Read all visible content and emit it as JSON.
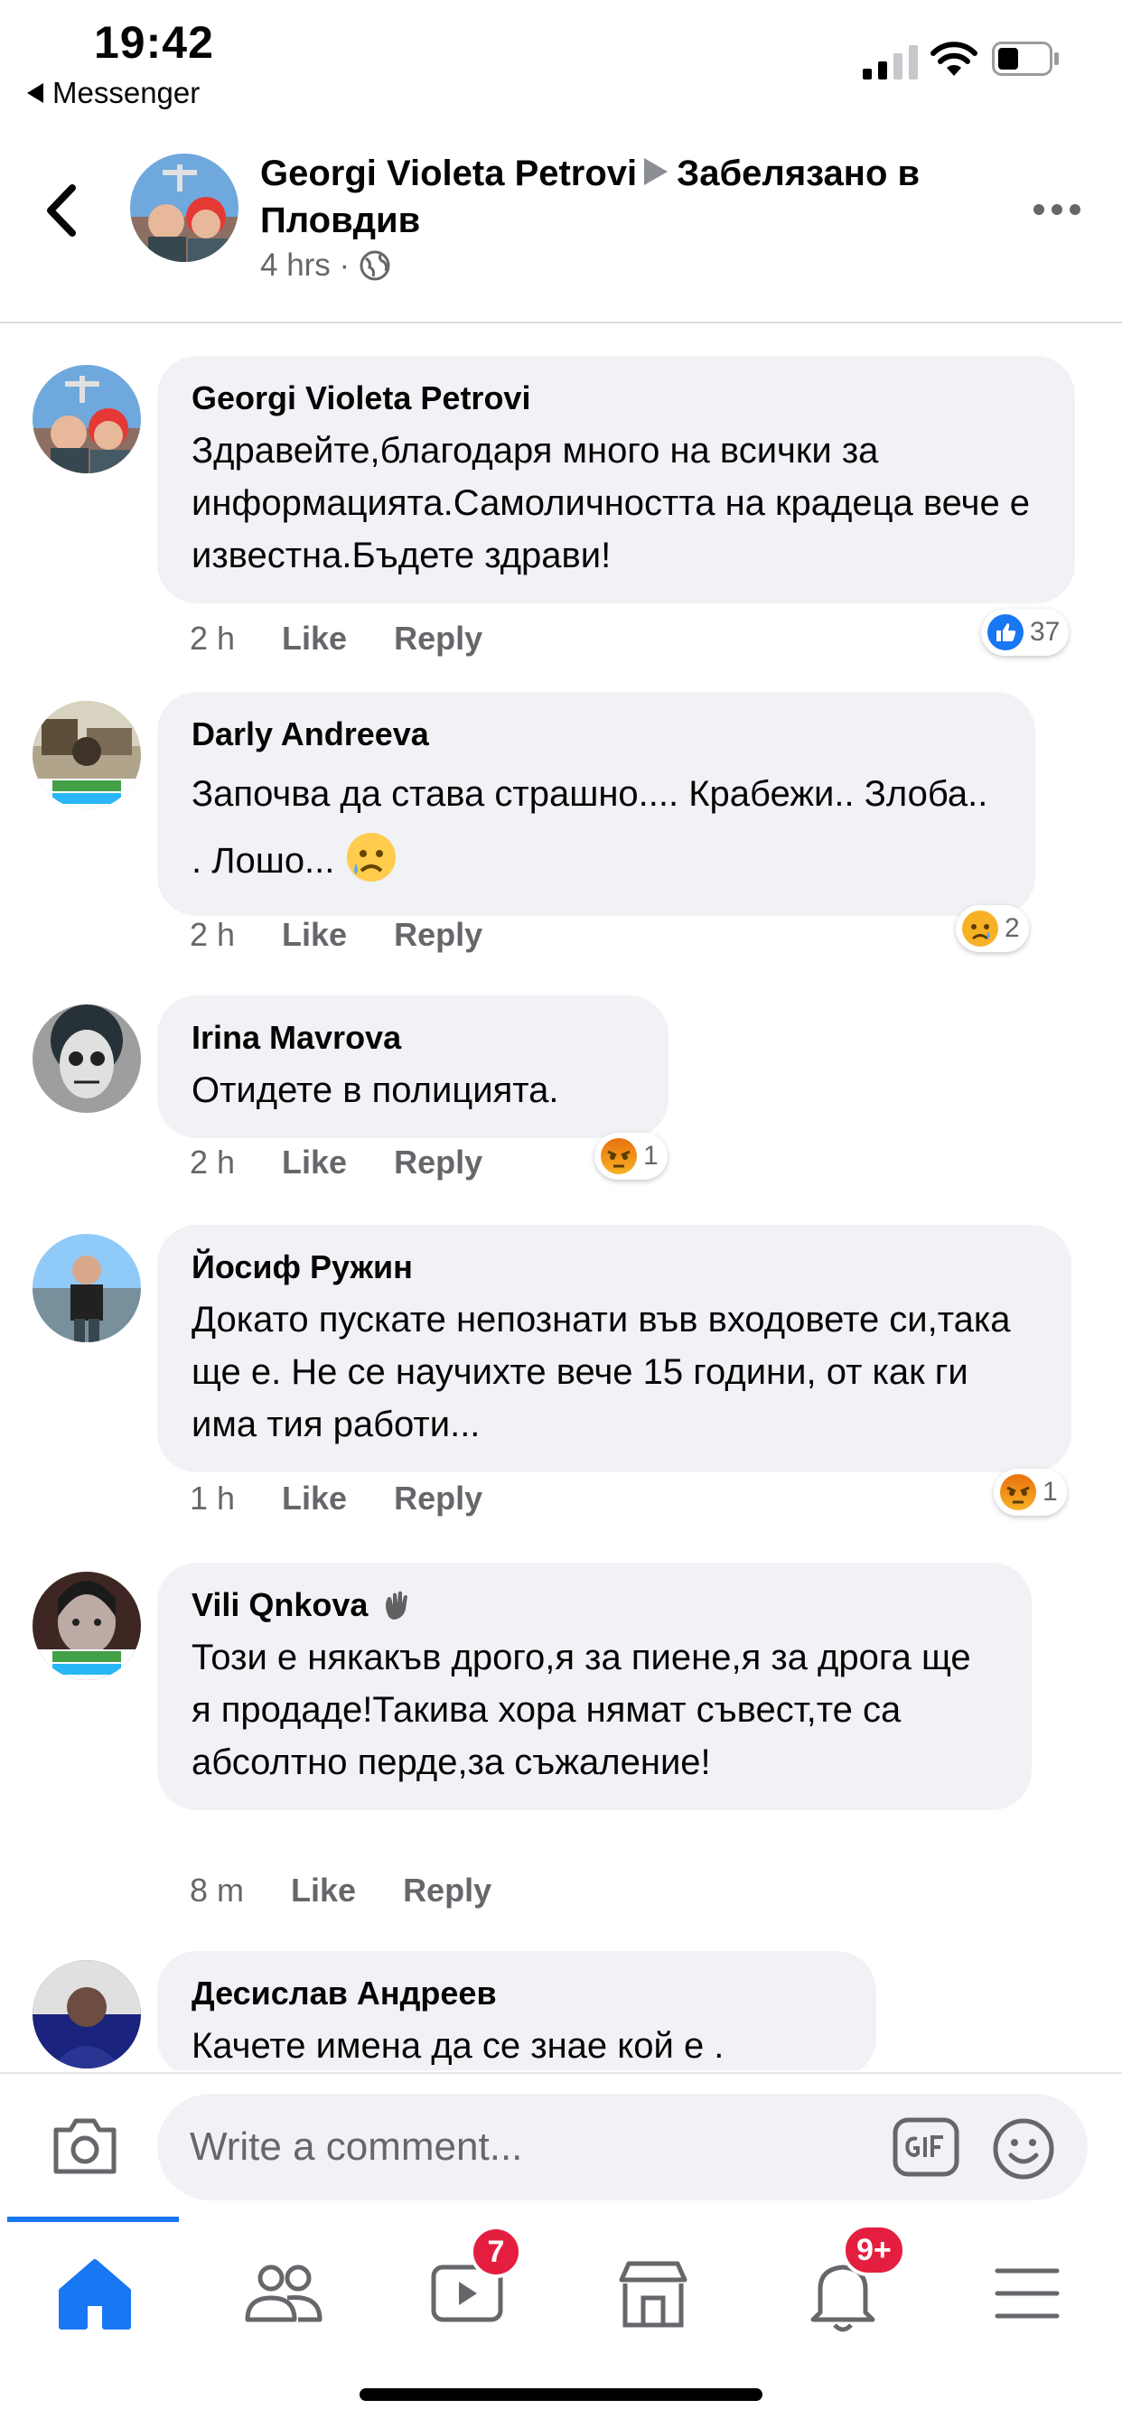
{
  "status_bar": {
    "time": "19:42",
    "back_app": "Messenger"
  },
  "header": {
    "author": "Georgi Violeta Petrovi",
    "location": "Забелязано в Пловдив",
    "meta": "4 hrs ·"
  },
  "comments": [
    {
      "author": "Georgi Violeta Petrovi",
      "text": "Здравейте,благодаря много на всички за информацията.Самоличността на крадеца вече е известна.Бъдете здрави!",
      "time": "2 h",
      "like": "Like",
      "reply": "Reply",
      "reaction": "like",
      "reaction_count": "37"
    },
    {
      "author": "Darly Andreeva",
      "text": "Започва да става страшно.... Крабежи.. Злоба.. . Лошо...",
      "time": "2 h",
      "like": "Like",
      "reply": "Reply",
      "reaction": "sad",
      "reaction_count": "2"
    },
    {
      "author": "Irina Mavrova",
      "text": "Отидете в полицията.",
      "time": "2 h",
      "like": "Like",
      "reply": "Reply",
      "reaction": "angry",
      "reaction_count": "1"
    },
    {
      "author": "Йосиф Ружин",
      "text": "Докато пускате непознати във входовете си,така ще е. Не се научихте вече 15 години, от как ги има тия работи...",
      "time": "1 h",
      "like": "Like",
      "reply": "Reply",
      "reaction": "angry",
      "reaction_count": "1"
    },
    {
      "author": "Vili Qnkova",
      "text": "Този е някакъв дрого,я за пиене,я за дрога ще я продаде!Такива хора нямат съвест,те са абсолтно перде,за съжаление!",
      "time": "8 m",
      "like": "Like",
      "reply": "Reply"
    },
    {
      "author": "Десислав Андреев",
      "text": "Качете имена да се знае кой е ."
    }
  ],
  "composer": {
    "placeholder": "Write a comment..."
  },
  "tabs": [
    {
      "icon": "home-icon",
      "active": true
    },
    {
      "icon": "friends-icon"
    },
    {
      "icon": "watch-icon",
      "badge": "7"
    },
    {
      "icon": "marketplace-icon"
    },
    {
      "icon": "notifications-icon",
      "badge": "9+"
    },
    {
      "icon": "menu-icon"
    }
  ],
  "colors": {
    "accent": "#1877f2",
    "bubble": "#f0f2f5",
    "secondary_text": "#65676b",
    "badge": "#e41e3f"
  }
}
